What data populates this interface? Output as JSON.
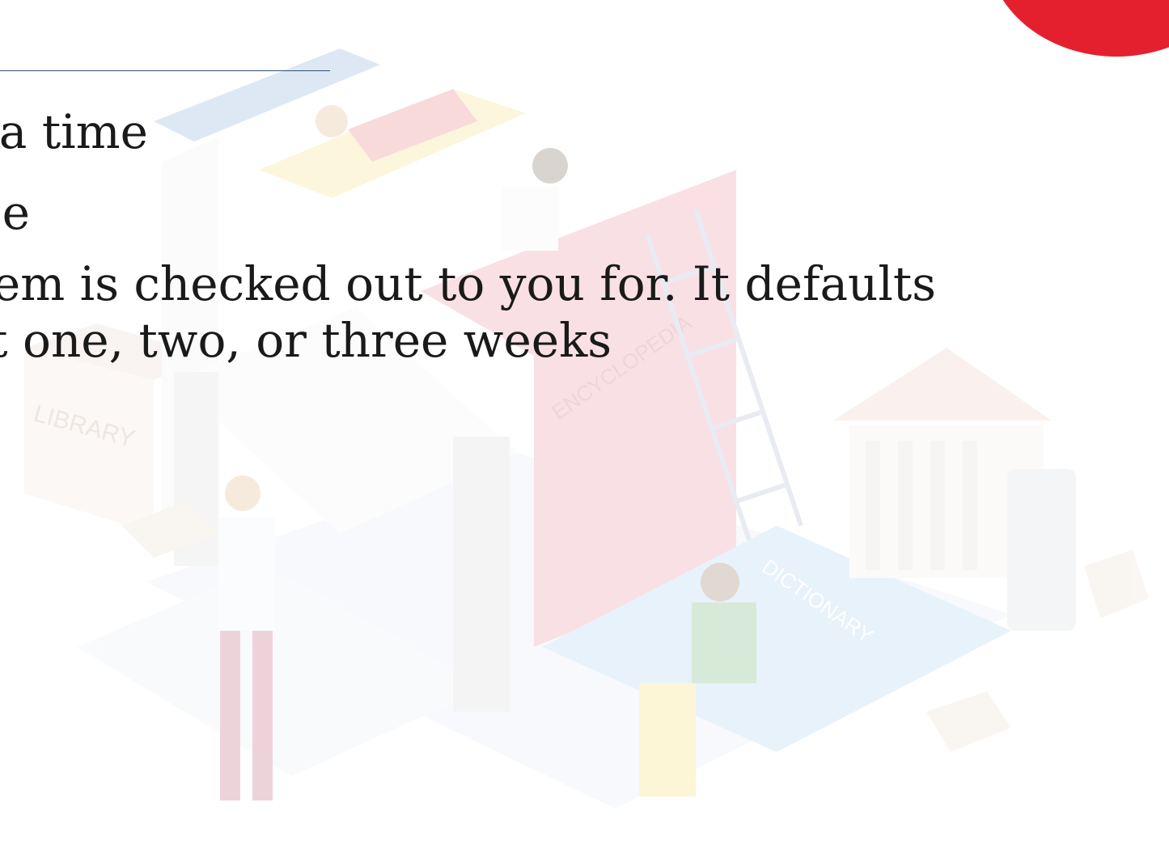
{
  "slide": {
    "lines": [
      "a time",
      "e",
      "em is checked out to you for. It defaults",
      "t one, two, or three weeks"
    ]
  },
  "illustration": {
    "book_spine_text": "ENCYCLOPEDIA",
    "dictionary_text": "DICTIONARY",
    "building_sign_text": "LIBRARY"
  },
  "colors": {
    "accent_red": "#e5202e",
    "rule_blue": "#2f4f77",
    "text": "#1a1a1a"
  }
}
